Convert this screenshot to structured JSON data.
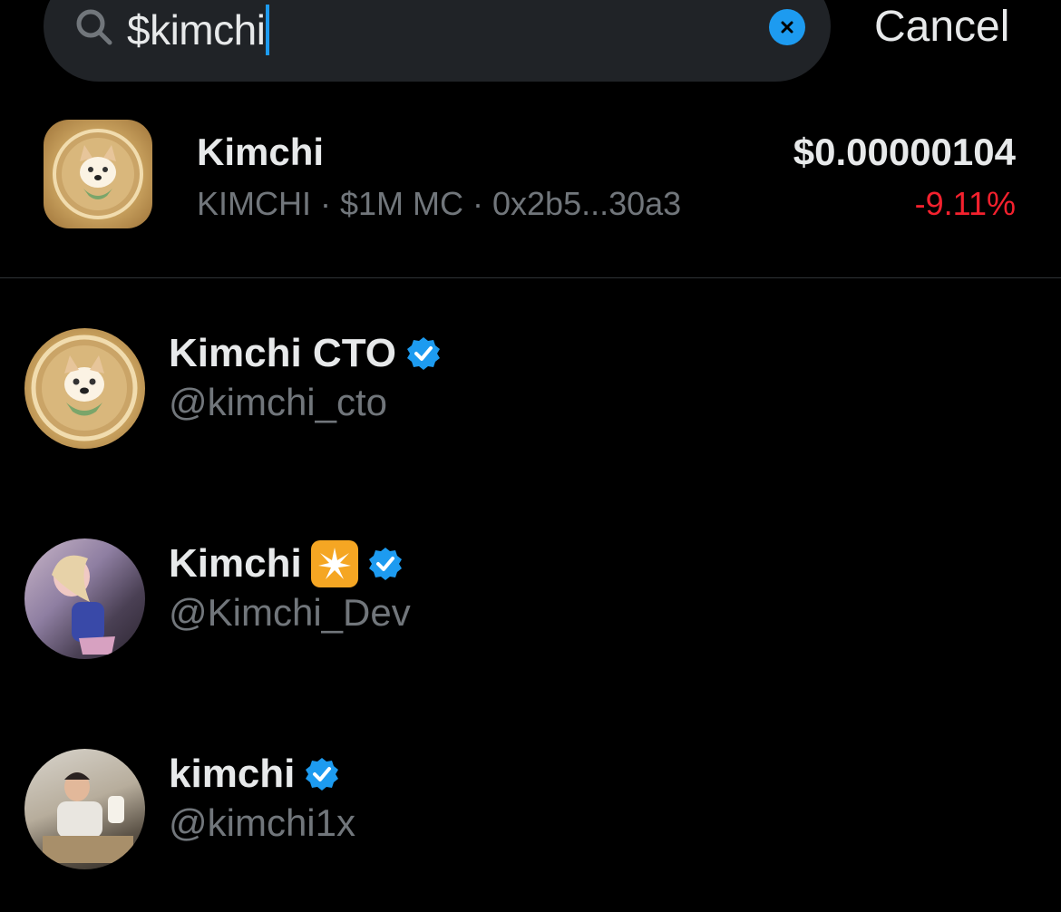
{
  "search": {
    "query": "$kimchi",
    "cancel_label": "Cancel"
  },
  "token": {
    "name": "Kimchi",
    "meta": "KIMCHI · $1M MC · 0x2b5...30a3",
    "price": "$0.00000104",
    "change": "-9.11%",
    "change_color": "#f4212e"
  },
  "users": [
    {
      "name": "Kimchi CTO",
      "handle": "@kimchi_cto",
      "verified": true
    },
    {
      "name": "Kimchi",
      "handle": "@Kimchi_Dev",
      "verified": true,
      "emoji": "sparkle-emoji"
    },
    {
      "name": "kimchi",
      "handle": "@kimchi1x",
      "verified": true
    }
  ],
  "colors": {
    "accent": "#1d9bf0",
    "background": "#000000",
    "secondary_text": "#71767b"
  }
}
